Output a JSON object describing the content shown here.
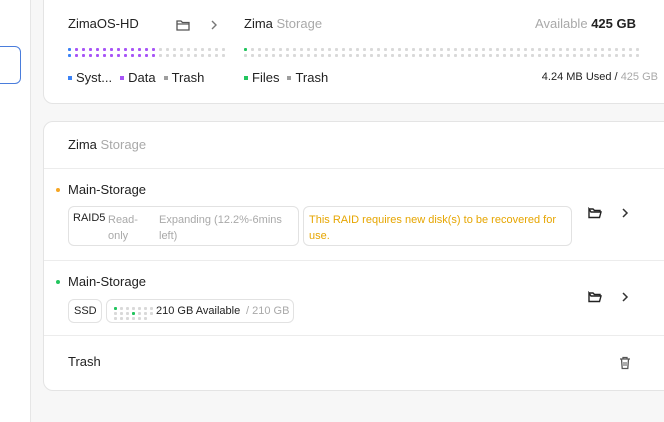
{
  "top_card": {
    "disk_name": "ZimaOS-HD",
    "storage_brand": "Zima",
    "storage_word": "Storage",
    "available_label": "Available",
    "available_value": "425 GB",
    "legend_left": [
      {
        "label": "Syst...",
        "color": "#3b82f6"
      },
      {
        "label": "Data",
        "color": "#a855f7"
      },
      {
        "label": "Trash",
        "color": "#9e9e9e"
      }
    ],
    "legend_right": [
      {
        "label": "Files",
        "color": "#22c55e"
      },
      {
        "label": "Trash",
        "color": "#9e9e9e"
      }
    ],
    "used_value": "4.24 MB Used /",
    "total_value": "425 GB"
  },
  "main_card": {
    "brand": "Zima",
    "word": "Storage",
    "storages": [
      {
        "name": "Main-Storage",
        "status_color": "#f5a623",
        "type": "RAID5",
        "state": "Read-only",
        "progress_text": "Expanding (12.2%-6mins left)",
        "warning": "This RAID requires new disk(s) to be recovered for use."
      },
      {
        "name": "Main-Storage",
        "status_color": "#22c55e",
        "type": "SSD",
        "available": "210 GB Available",
        "total": "/ 210 GB"
      }
    ],
    "trash_label": "Trash"
  }
}
